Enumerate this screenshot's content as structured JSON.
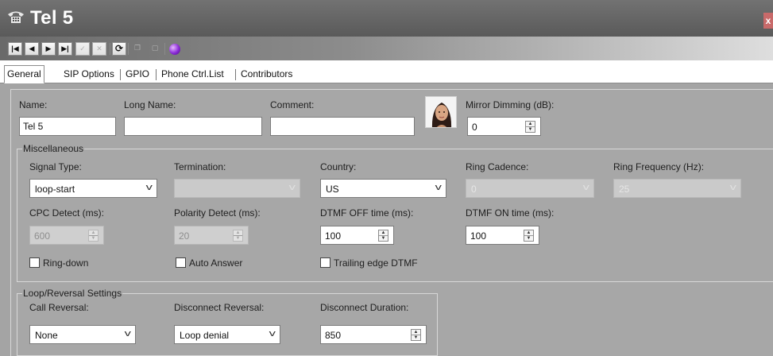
{
  "window": {
    "title": "Tel 5",
    "close_glyph": "x"
  },
  "toolbar": {
    "icons": [
      "first-record-icon",
      "previous-record-icon",
      "next-record-icon",
      "last-record-icon",
      "confirm-icon",
      "cancel-icon",
      "refresh-icon",
      "copy-icon",
      "paste-icon",
      "globe-icon"
    ]
  },
  "tabs": [
    {
      "label": "General",
      "active": true
    },
    {
      "label": "SIP Options"
    },
    {
      "label": "GPIO"
    },
    {
      "label": "Phone Ctrl.List"
    },
    {
      "label": "Contributors"
    }
  ],
  "general": {
    "name_label": "Name:",
    "name_value": "Tel 5",
    "long_name_label": "Long Name:",
    "long_name_value": "",
    "comment_label": "Comment:",
    "comment_value": "",
    "mirror_dimming_label": "Mirror Dimming (dB):",
    "mirror_dimming_value": "0"
  },
  "misc": {
    "title": "Miscellaneous",
    "signal_type_label": "Signal Type:",
    "signal_type_value": "loop-start",
    "termination_label": "Termination:",
    "termination_value": "",
    "country_label": "Country:",
    "country_value": "US",
    "ring_cadence_label": "Ring Cadence:",
    "ring_cadence_value": "0",
    "ring_frequency_label": "Ring Frequency (Hz):",
    "ring_frequency_value": "25",
    "cpc_detect_label": "CPC Detect (ms):",
    "cpc_detect_value": "600",
    "polarity_detect_label": "Polarity Detect  (ms):",
    "polarity_detect_value": "20",
    "dtmf_off_label": "DTMF OFF time (ms):",
    "dtmf_off_value": "100",
    "dtmf_on_label": "DTMF ON time (ms):",
    "dtmf_on_value": "100",
    "ring_down_label": "Ring-down",
    "auto_answer_label": "Auto Answer",
    "trailing_edge_label": "Trailing edge DTMF"
  },
  "loop": {
    "title": "Loop/Reversal Settings",
    "call_reversal_label": "Call Reversal:",
    "call_reversal_value": "None",
    "disconnect_reversal_label": "Disconnect Reversal:",
    "disconnect_reversal_value": "Loop denial",
    "disconnect_duration_label": "Disconnect Duration:",
    "disconnect_duration_value": "850"
  },
  "colors": {
    "title_bar": "#636363",
    "panel": "#a7a7a7",
    "close_button": "#c86a6a",
    "globe": "#8a2bd6"
  }
}
